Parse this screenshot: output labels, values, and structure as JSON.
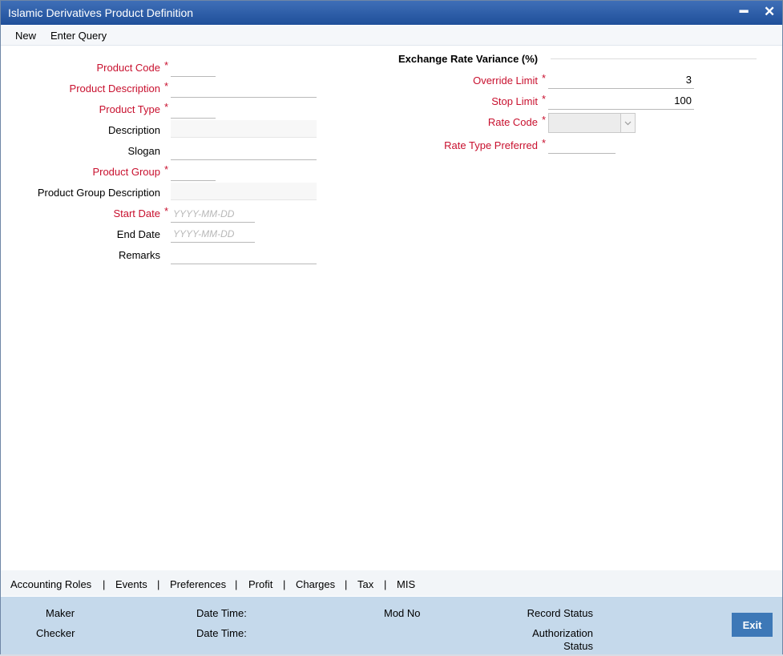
{
  "window": {
    "title": "Islamic Derivatives Product Definition",
    "minimize_glyph": "━",
    "close_glyph": "✕"
  },
  "menu": {
    "new_label": "New",
    "enter_query_label": "Enter Query"
  },
  "form": {
    "product_code": {
      "label": "Product Code",
      "required": "*",
      "value": ""
    },
    "product_description": {
      "label": "Product Description",
      "required": "*",
      "value": ""
    },
    "product_type": {
      "label": "Product Type",
      "required": "*",
      "value": ""
    },
    "description": {
      "label": "Description",
      "value": ""
    },
    "slogan": {
      "label": "Slogan",
      "value": ""
    },
    "product_group": {
      "label": "Product Group",
      "required": "*",
      "value": ""
    },
    "product_group_description": {
      "label": "Product Group Description",
      "value": ""
    },
    "start_date": {
      "label": "Start Date",
      "required": "*",
      "placeholder": "YYYY-MM-DD",
      "value": ""
    },
    "end_date": {
      "label": "End Date",
      "placeholder": "YYYY-MM-DD",
      "value": ""
    },
    "remarks": {
      "label": "Remarks",
      "value": ""
    }
  },
  "exchange_rate_variance": {
    "heading": "Exchange Rate Variance (%)",
    "override_limit": {
      "label": "Override Limit",
      "required": "*",
      "value": "3"
    },
    "stop_limit": {
      "label": "Stop Limit",
      "required": "*",
      "value": "100"
    },
    "rate_code": {
      "label": "Rate Code",
      "required": "*",
      "value": "",
      "icon": "chevron-down-icon"
    },
    "rate_type_preferred": {
      "label": "Rate Type Preferred",
      "required": "*",
      "value": ""
    }
  },
  "tabs": [
    "Accounting Roles",
    "Events",
    "Preferences",
    "Profit",
    "Charges",
    "Tax",
    "MIS"
  ],
  "tab_separator": "|",
  "footer": {
    "maker": "Maker",
    "checker": "Checker",
    "date_time_1": "Date Time:",
    "date_time_2": "Date Time:",
    "mod_no": "Mod No",
    "record_status": "Record Status",
    "authorization_status_line1": "Authorization",
    "authorization_status_line2": "Status",
    "exit_label": "Exit"
  },
  "colors": {
    "titlebar": "#2a5ba6",
    "required": "#c8102e",
    "footer": "#c5d9eb",
    "exit_button": "#3d78b7"
  }
}
